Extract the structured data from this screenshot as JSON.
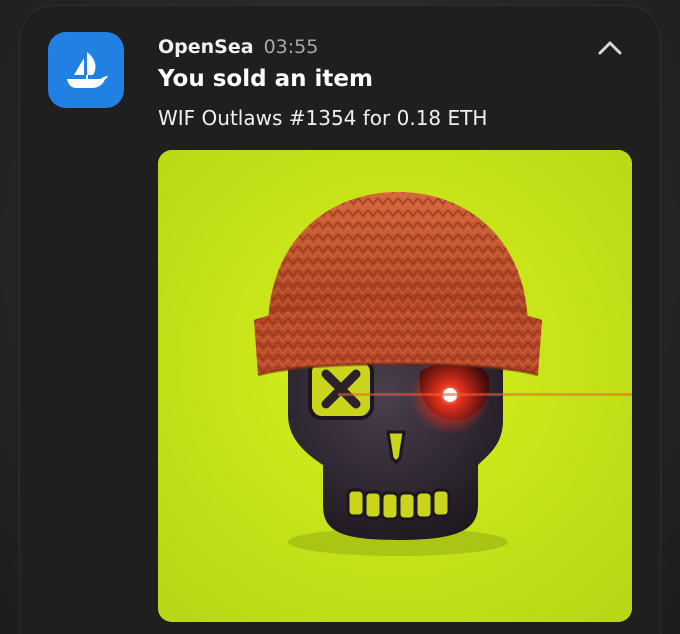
{
  "notification": {
    "app_name": "OpenSea",
    "time": "03:55",
    "title": "You sold an item",
    "body": "WIF Outlaws #1354 for 0.18 ETH",
    "app_icon": "opensea-ship-icon",
    "collapse_icon": "chevron-up-icon",
    "image": "nft-skull-beanie-image"
  },
  "colors": {
    "card_background": "#1f1f1f",
    "app_icon_background": "#2081e2",
    "image_background": "#c6e51a",
    "beanie": "#c1502a",
    "skull": "#2d2530",
    "eye_glow": "#ff2a1a"
  }
}
